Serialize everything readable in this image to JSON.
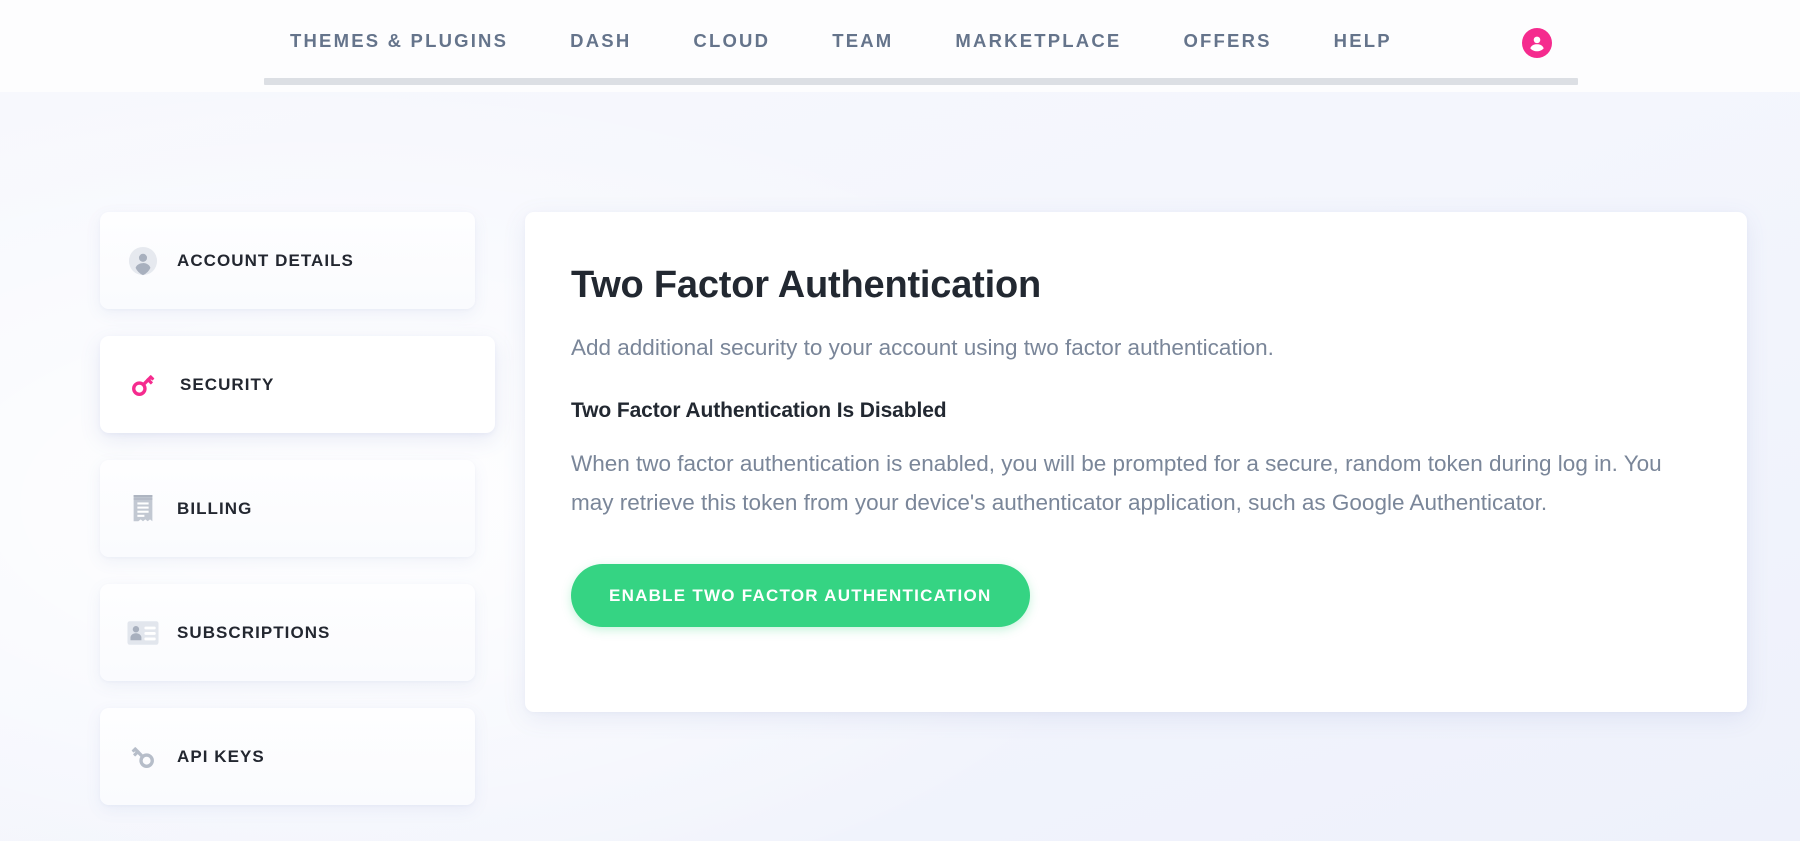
{
  "nav": {
    "items": [
      {
        "label": "Themes & Plugins",
        "name": "nav-themes-plugins"
      },
      {
        "label": "Dash",
        "name": "nav-dash"
      },
      {
        "label": "Cloud",
        "name": "nav-cloud"
      },
      {
        "label": "Team",
        "name": "nav-team"
      },
      {
        "label": "Marketplace",
        "name": "nav-marketplace"
      },
      {
        "label": "Offers",
        "name": "nav-offers"
      },
      {
        "label": "Help",
        "name": "nav-help"
      }
    ],
    "avatar_icon": "user-avatar-icon",
    "avatar_color": "#f52b8e"
  },
  "sidebar": {
    "items": [
      {
        "label": "Account Details",
        "icon": "account-avatar-icon",
        "active": false
      },
      {
        "label": "Security",
        "icon": "key-icon",
        "active": true
      },
      {
        "label": "Billing",
        "icon": "receipt-icon",
        "active": false
      },
      {
        "label": "Subscriptions",
        "icon": "id-card-icon",
        "active": false
      },
      {
        "label": "API Keys",
        "icon": "api-key-icon",
        "active": false
      }
    ],
    "active_icon_color": "#f52b8e",
    "inactive_icon_color": "#b6bdc9"
  },
  "main": {
    "title": "Two Factor Authentication",
    "subtitle": "Add additional security to your account using two factor authentication.",
    "status_heading": "Two Factor Authentication Is Disabled",
    "body": "When two factor authentication is enabled, you will be prompted for a secure, random token during log in. You may retrieve this token from your device's authenticator application, such as Google Authenticator.",
    "enable_button_label": "Enable Two Factor Authentication",
    "enable_button_color": "#35d483"
  }
}
